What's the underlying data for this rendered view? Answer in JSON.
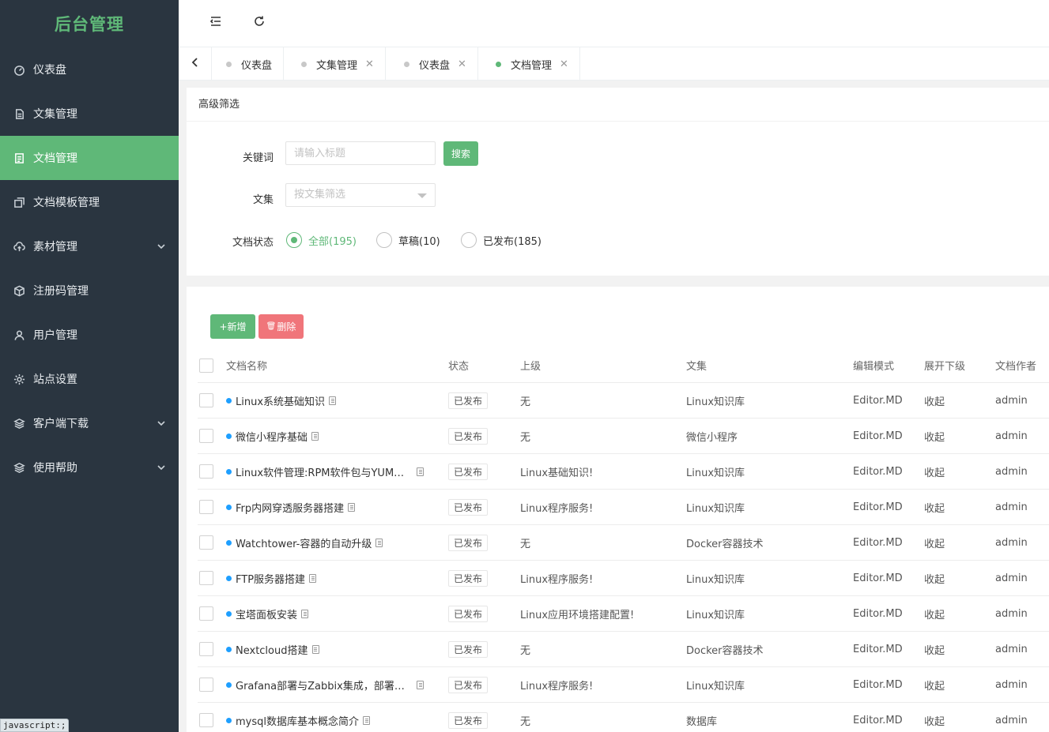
{
  "sidebar": {
    "brand": "后台管理",
    "items": [
      {
        "label": "仪表盘",
        "icon": "dashboard-icon",
        "active": false,
        "expandable": false
      },
      {
        "label": "文集管理",
        "icon": "file-icon",
        "active": false,
        "expandable": false
      },
      {
        "label": "文档管理",
        "icon": "document-icon",
        "active": true,
        "expandable": false
      },
      {
        "label": "文档模板管理",
        "icon": "template-icon",
        "active": false,
        "expandable": false
      },
      {
        "label": "素材管理",
        "icon": "cloud-upload-icon",
        "active": false,
        "expandable": true
      },
      {
        "label": "注册码管理",
        "icon": "box-icon",
        "active": false,
        "expandable": false
      },
      {
        "label": "用户管理",
        "icon": "user-icon",
        "active": false,
        "expandable": false
      },
      {
        "label": "站点设置",
        "icon": "gear-icon",
        "active": false,
        "expandable": false
      },
      {
        "label": "客户端下载",
        "icon": "layers-icon",
        "active": false,
        "expandable": true
      },
      {
        "label": "使用帮助",
        "icon": "layers-icon",
        "active": false,
        "expandable": true
      }
    ]
  },
  "statusbar": {
    "text": "javascript:;"
  },
  "tabs": [
    {
      "label": "仪表盘",
      "closable": false,
      "active": false
    },
    {
      "label": "文集管理",
      "closable": true,
      "active": false
    },
    {
      "label": "仪表盘",
      "closable": true,
      "active": false
    },
    {
      "label": "文档管理",
      "closable": true,
      "active": true
    }
  ],
  "filter": {
    "title": "高级筛选",
    "keyword_label": "关键词",
    "keyword_placeholder": "请输入标题",
    "search_label": "搜索",
    "collection_label": "文集",
    "collection_placeholder": "按文集筛选",
    "status_label": "文档状态",
    "status_options": [
      {
        "label": "全部(195)",
        "checked": true
      },
      {
        "label": "草稿(10)",
        "checked": false
      },
      {
        "label": "已发布(185)",
        "checked": false
      }
    ]
  },
  "toolbar": {
    "add_label": "+新增",
    "delete_label": "删除"
  },
  "table": {
    "headers": {
      "name": "文档名称",
      "status": "状态",
      "parent": "上级",
      "collection": "文集",
      "editor": "编辑模式",
      "expand": "展开下级",
      "author": "文档作者"
    },
    "rows": [
      {
        "name": "Linux系统基础知识",
        "status": "已发布",
        "parent": "无",
        "collection": "Linux知识库",
        "editor": "Editor.MD",
        "expand": "收起",
        "author": "admin"
      },
      {
        "name": "微信小程序基础",
        "status": "已发布",
        "parent": "无",
        "collection": "微信小程序",
        "editor": "Editor.MD",
        "expand": "收起",
        "author": "admin"
      },
      {
        "name": "Linux软件管理:RPM软件包与YUM管理...",
        "status": "已发布",
        "parent": "Linux基础知识!",
        "collection": "Linux知识库",
        "editor": "Editor.MD",
        "expand": "收起",
        "author": "admin"
      },
      {
        "name": "Frp内网穿透服务器搭建",
        "status": "已发布",
        "parent": "Linux程序服务!",
        "collection": "Linux知识库",
        "editor": "Editor.MD",
        "expand": "收起",
        "author": "admin"
      },
      {
        "name": "Watchtower-容器的自动升级",
        "status": "已发布",
        "parent": "无",
        "collection": "Docker容器技术",
        "editor": "Editor.MD",
        "expand": "收起",
        "author": "admin"
      },
      {
        "name": "FTP服务器搭建",
        "status": "已发布",
        "parent": "Linux程序服务!",
        "collection": "Linux知识库",
        "editor": "Editor.MD",
        "expand": "收起",
        "author": "admin"
      },
      {
        "name": "宝塔面板安装",
        "status": "已发布",
        "parent": "Linux应用环境搭建配置!",
        "collection": "Linux知识库",
        "editor": "Editor.MD",
        "expand": "收起",
        "author": "admin"
      },
      {
        "name": "Nextcloud搭建",
        "status": "已发布",
        "parent": "无",
        "collection": "Docker容器技术",
        "editor": "Editor.MD",
        "expand": "收起",
        "author": "admin"
      },
      {
        "name": "Grafana部署与Zabbix集成，部署开源l...",
        "status": "已发布",
        "parent": "Linux程序服务!",
        "collection": "Linux知识库",
        "editor": "Editor.MD",
        "expand": "收起",
        "author": "admin"
      },
      {
        "name": "mysql数据库基本概念简介",
        "status": "已发布",
        "parent": "无",
        "collection": "数据库",
        "editor": "Editor.MD",
        "expand": "收起",
        "author": "admin"
      }
    ]
  }
}
